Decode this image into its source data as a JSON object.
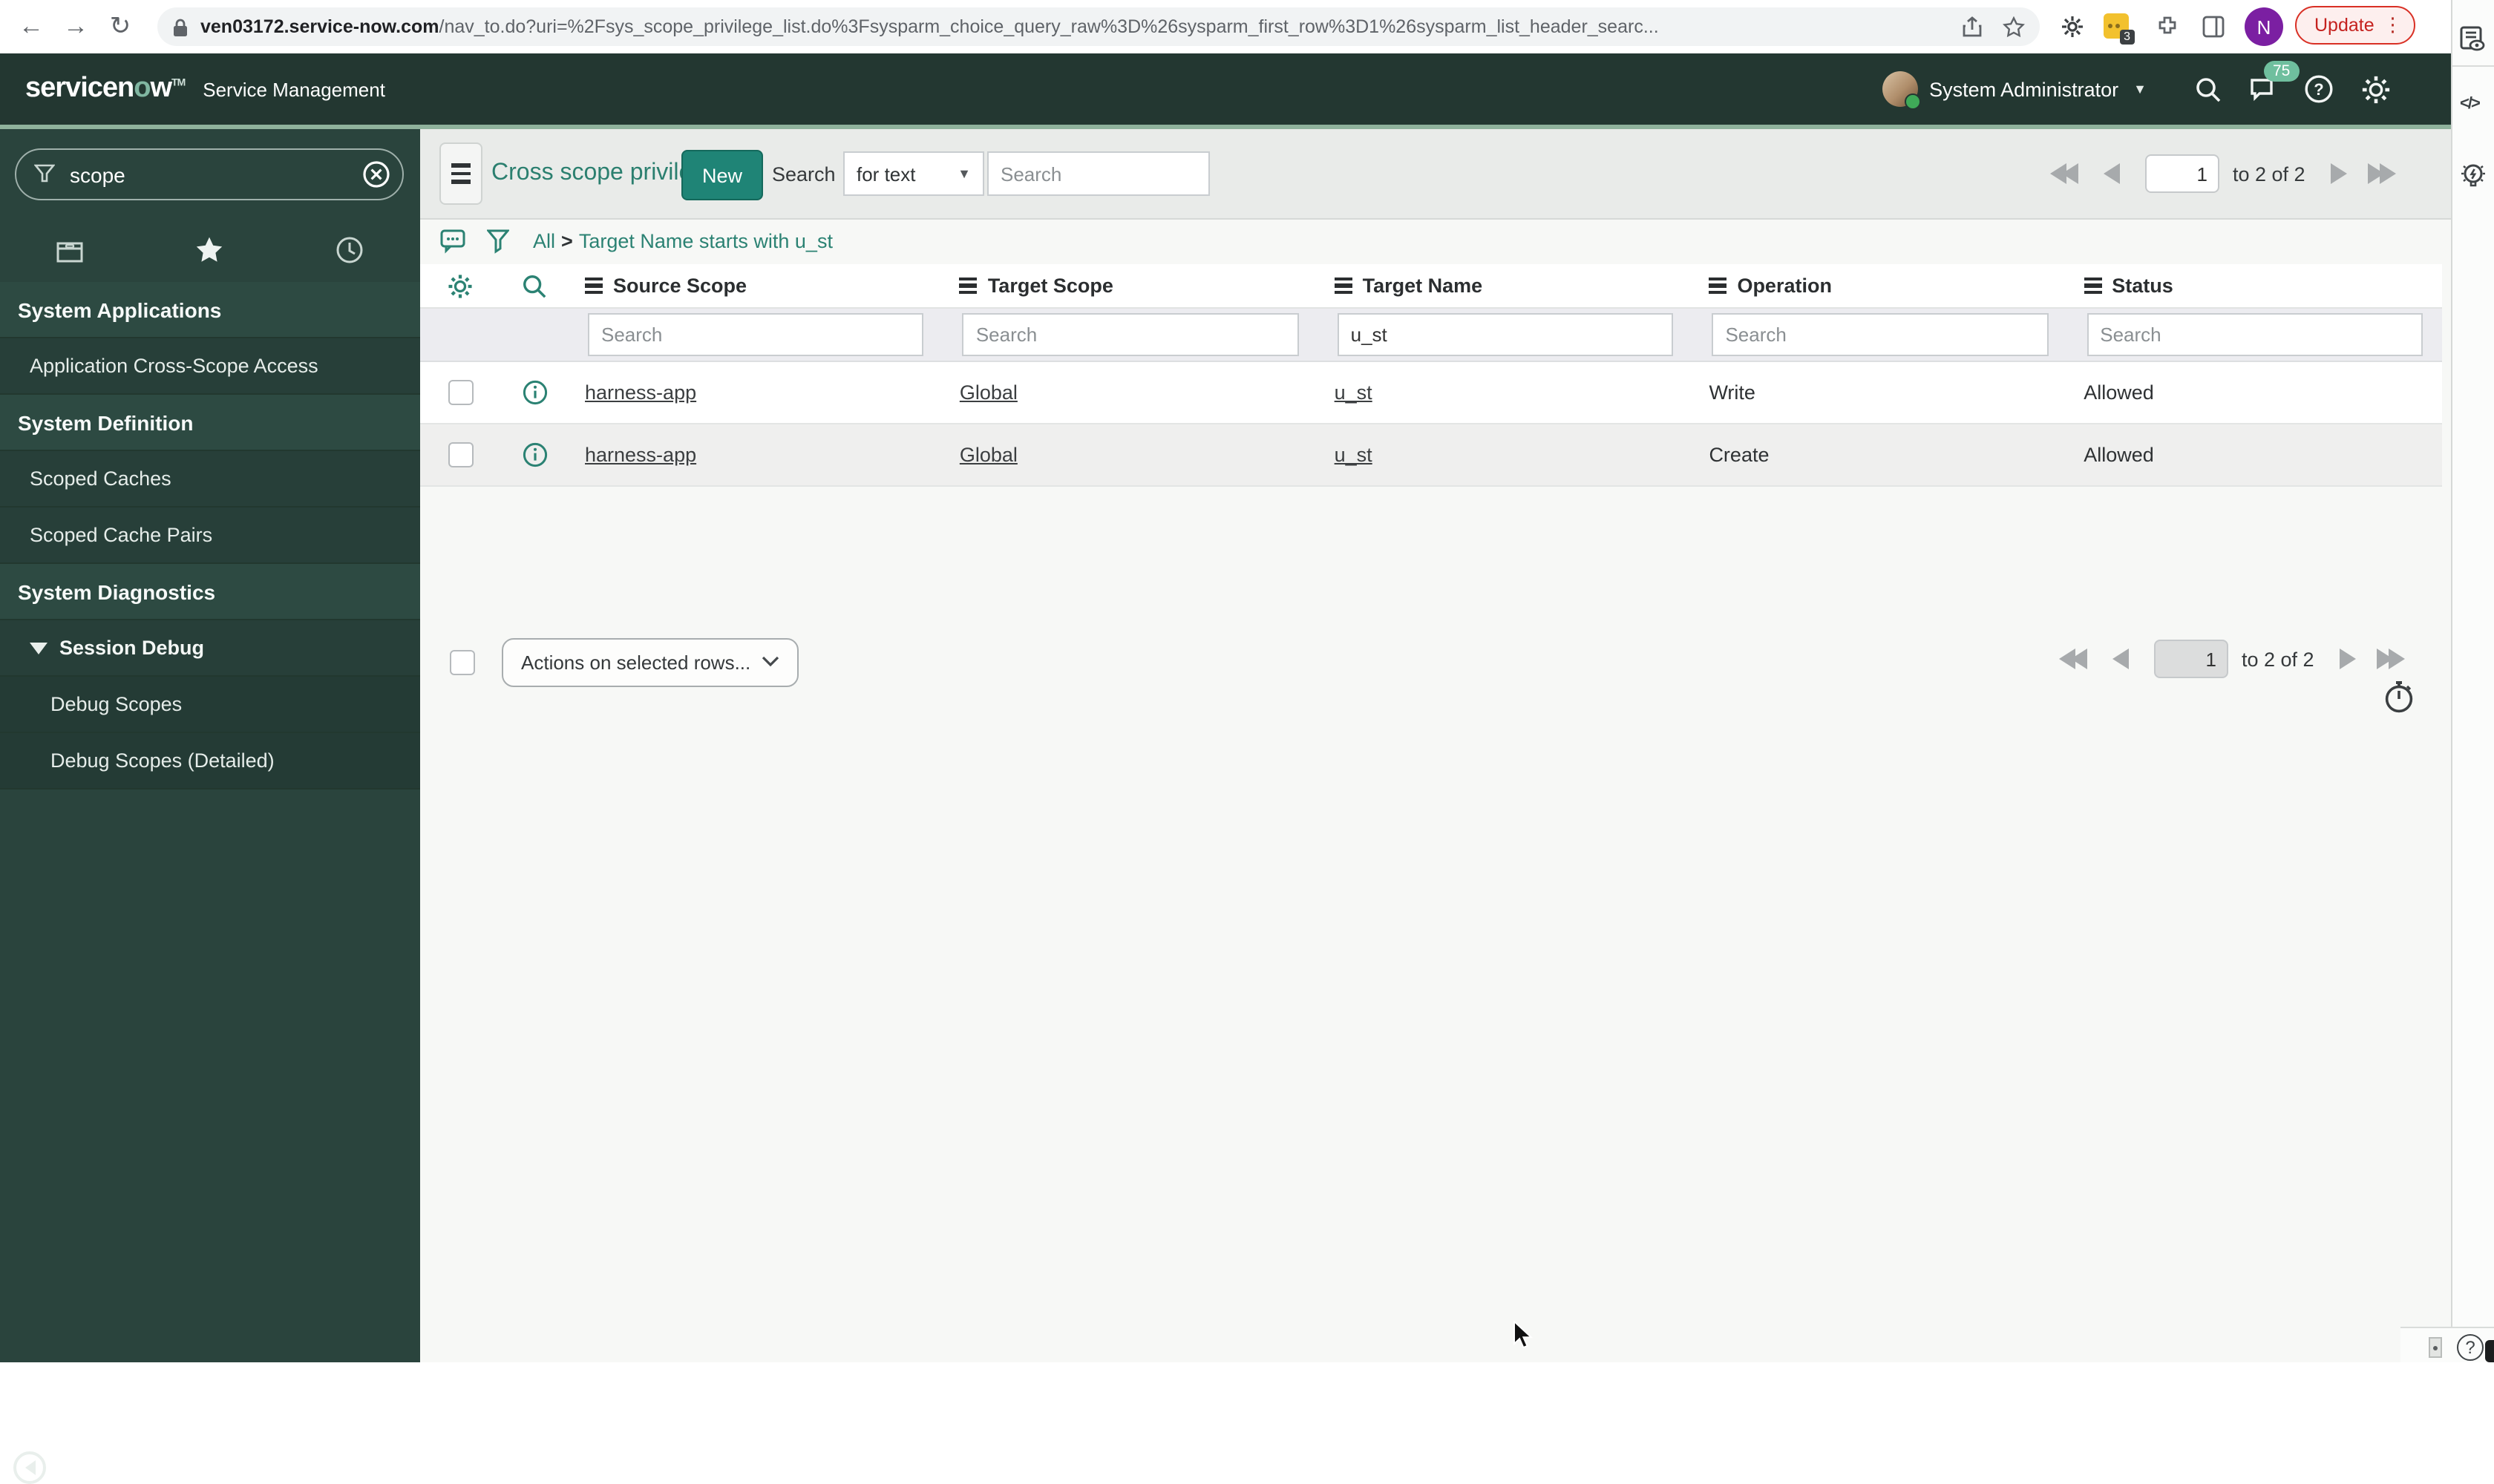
{
  "browser": {
    "url_domain": "ven03172.service-now.com",
    "url_path": "/nav_to.do?uri=%2Fsys_scope_privilege_list.do%3Fsysparm_choice_query_raw%3D%26sysparm_first_row%3D1%26sysparm_list_header_searc...",
    "update_label": "Update",
    "profile_initial": "N",
    "extension_badge": "3"
  },
  "banner": {
    "logo_pre": "servicen",
    "logo_o": "o",
    "logo_post": "w",
    "product": "Service Management",
    "user_name": "System Administrator",
    "notification_count": "75"
  },
  "sidebar": {
    "filter_value": "scope",
    "items": [
      {
        "label": "System Applications"
      },
      {
        "label": "Application Cross-Scope Access"
      },
      {
        "label": "System Definition"
      },
      {
        "label": "Scoped Caches"
      },
      {
        "label": "Scoped Cache Pairs"
      },
      {
        "label": "System Diagnostics"
      },
      {
        "label": "Session Debug"
      },
      {
        "label": "Debug Scopes"
      },
      {
        "label": "Debug Scopes (Detailed)"
      }
    ]
  },
  "list": {
    "title": "Cross scope privileges",
    "new_label": "New",
    "search_label": "Search",
    "search_type": "for text",
    "search_placeholder": "Search",
    "breadcrumb": {
      "root": "All",
      "sep": ">",
      "filter": "Target Name starts with u_st"
    },
    "columns": [
      {
        "label": "Source Scope"
      },
      {
        "label": "Target Scope"
      },
      {
        "label": "Target Name"
      },
      {
        "label": "Operation"
      },
      {
        "label": "Status"
      }
    ],
    "filter_row": {
      "placeholder": "Search",
      "target_name_value": "u_st"
    },
    "rows": [
      {
        "source_scope": "harness-app",
        "target_scope": "Global",
        "target_name": "u_st",
        "operation": "Write",
        "status": "Allowed"
      },
      {
        "source_scope": "harness-app",
        "target_scope": "Global",
        "target_name": "u_st",
        "operation": "Create",
        "status": "Allowed"
      }
    ],
    "actions_label": "Actions on selected rows...",
    "pagination": {
      "page": "1",
      "range_label": "to 2 of 2"
    }
  }
}
